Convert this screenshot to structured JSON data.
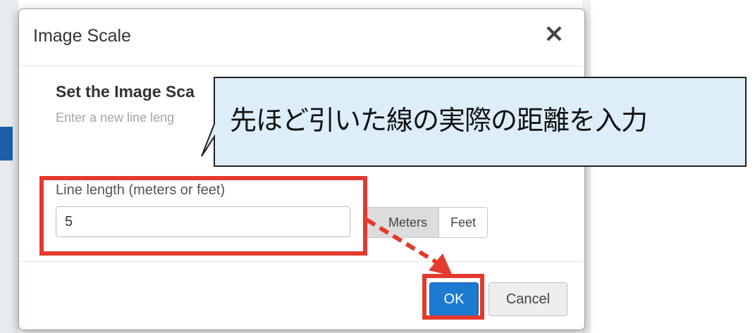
{
  "dialog": {
    "title": "Image Scale",
    "close_icon": "close-icon",
    "section_title": "Set the Image Sca",
    "section_subtitle": "Enter a new line leng",
    "field_label": "Line length (meters or feet)",
    "field_value": "5",
    "units": [
      "Meters",
      "Feet"
    ],
    "selected_unit": "Meters",
    "ok_label": "OK",
    "cancel_label": "Cancel"
  },
  "annotation": {
    "callout_text": "先ほど引いた線の実際の距離を入力",
    "highlight_color": "#e43a2e",
    "callout_fill": "#ddeef8"
  },
  "colors": {
    "primary_button": "#1c7ad1",
    "selected_unit_bg": "#dcdcdc"
  }
}
